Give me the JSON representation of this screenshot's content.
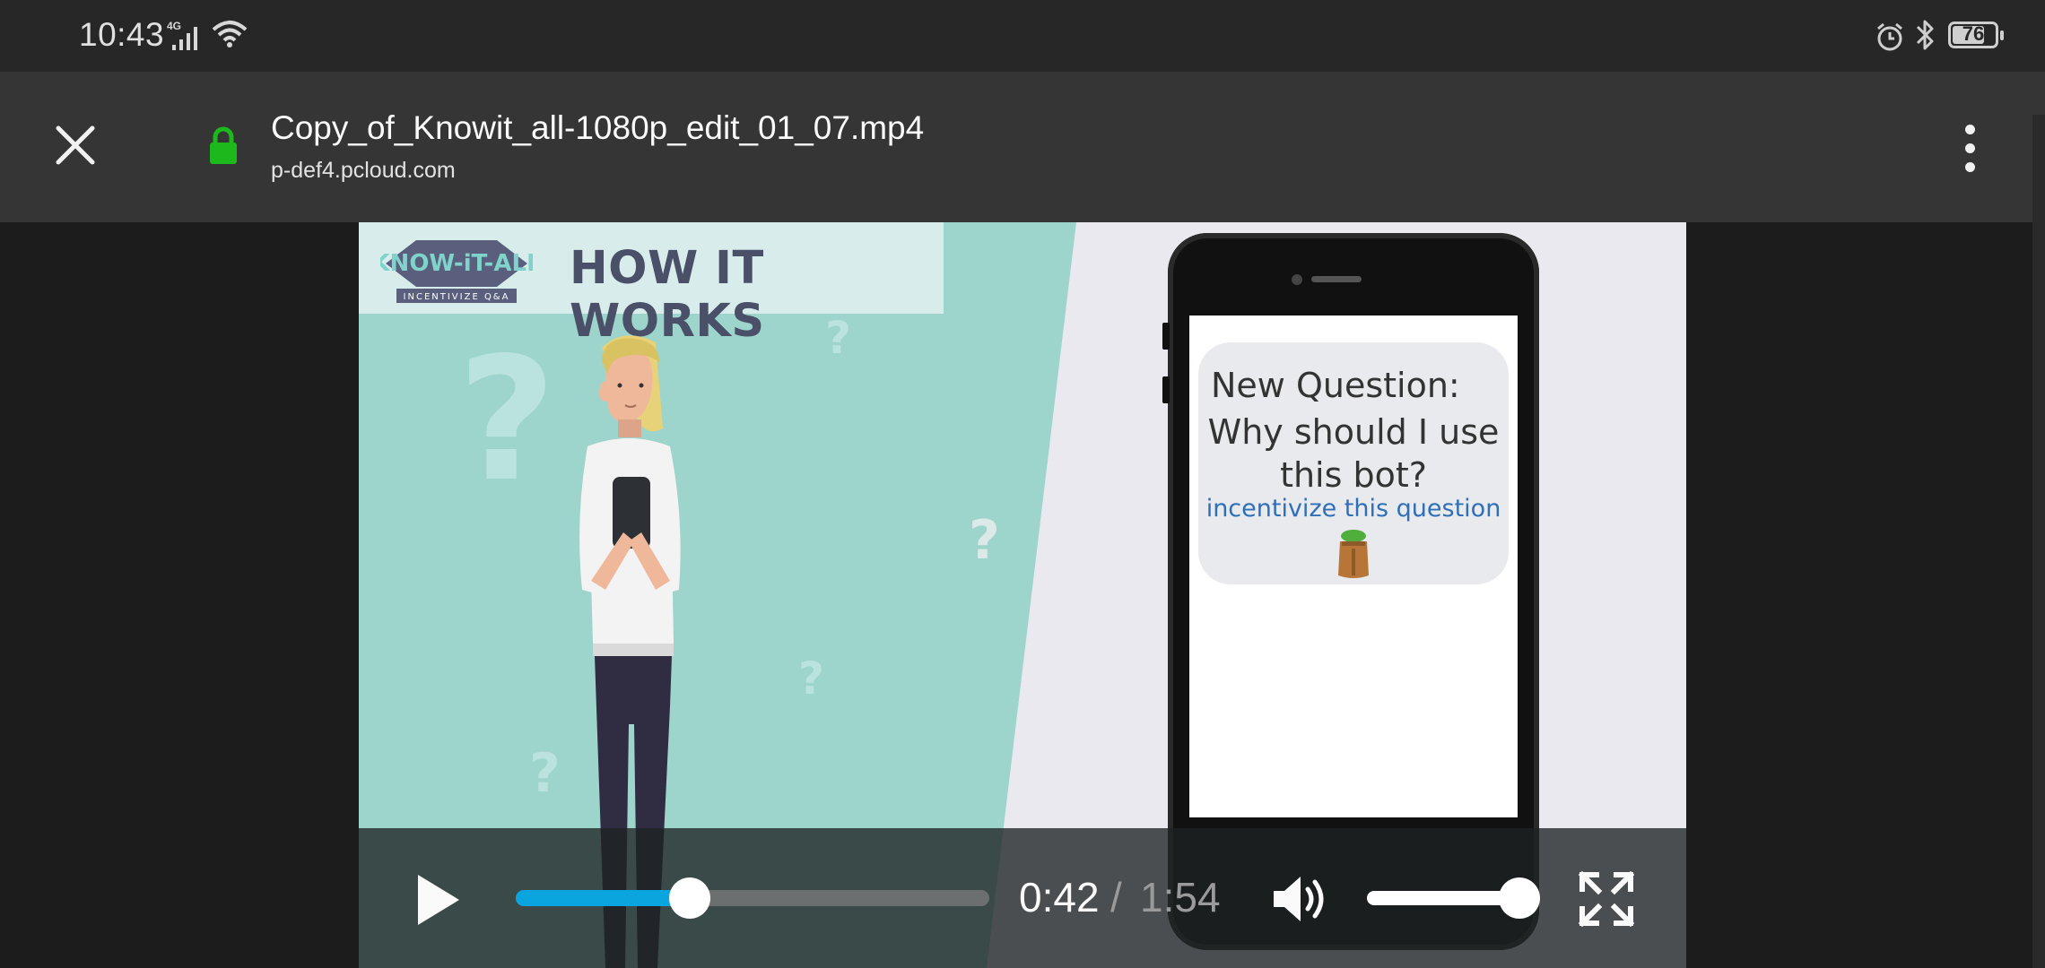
{
  "status_bar": {
    "time": "10:43",
    "network_label": "4G",
    "battery_level": "76",
    "battery_fraction": 0.76
  },
  "header": {
    "title": "Copy_of_Knowit_all-1080p_edit_01_07.mp4",
    "url": "p-def4.pcloud.com"
  },
  "video": {
    "banner_title": "HOW IT WORKS",
    "logo_text": "KNOW-iT-ALL",
    "logo_subtext": "INCENTIVIZE Q&A",
    "question_line1": "New Question:",
    "question_line2": "Why should I use",
    "question_line3": "this bot?",
    "incentivize_link": "incentivize this question"
  },
  "controls": {
    "current_time": "0:42",
    "separator": "/",
    "total_time": "1:54",
    "progress_fraction": 0.368,
    "volume_fraction": 1.0
  },
  "colors": {
    "accent": "#0aa4df",
    "lock": "#1cb81c",
    "teal_background": "#9dd4cb"
  }
}
